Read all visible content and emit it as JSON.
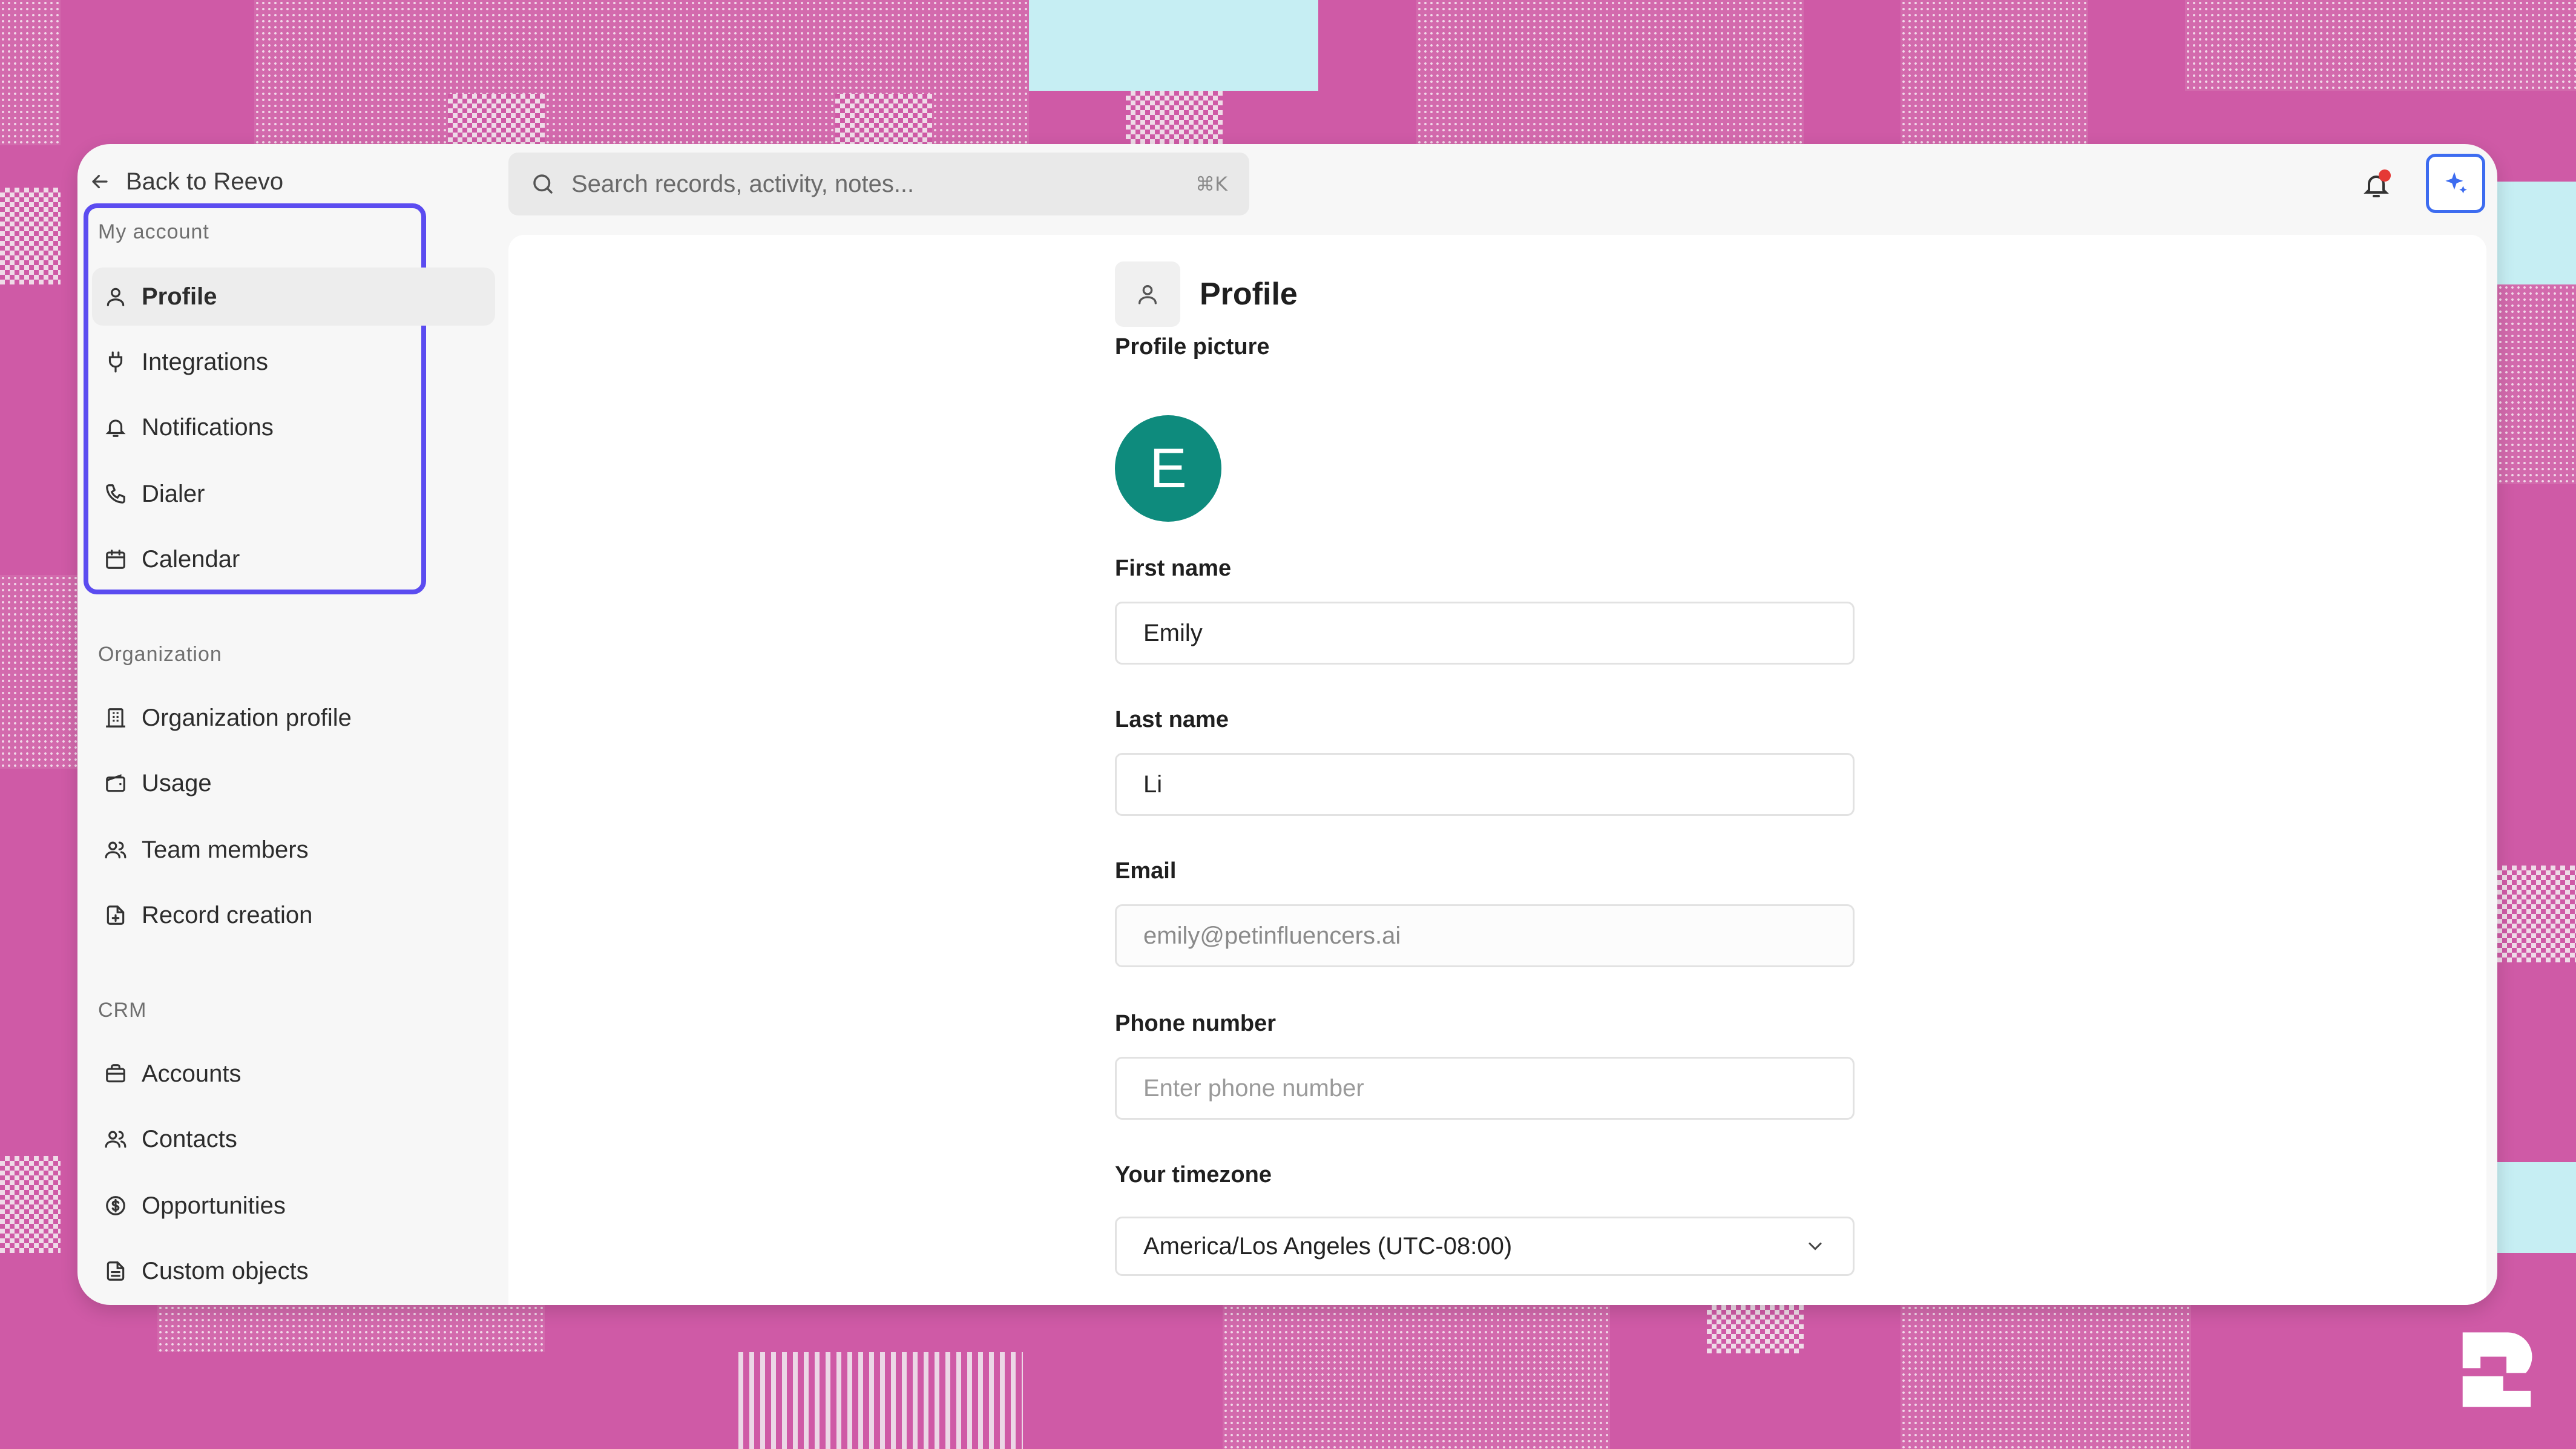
{
  "sidebar": {
    "back_label": "Back to Reevo",
    "sections": {
      "my_account": "My account",
      "organization": "Organization",
      "crm": "CRM"
    },
    "items": {
      "profile": "Profile",
      "integrations": "Integrations",
      "notifications": "Notifications",
      "dialer": "Dialer",
      "calendar": "Calendar",
      "organization_profile": "Organization profile",
      "usage": "Usage",
      "team_members": "Team members",
      "record_creation": "Record creation",
      "accounts": "Accounts",
      "contacts": "Contacts",
      "opportunities": "Opportunities",
      "custom_objects": "Custom objects"
    },
    "active_item": "Profile"
  },
  "search": {
    "placeholder": "Search records, activity, notes...",
    "shortcut": "⌘K"
  },
  "profile": {
    "title": "Profile",
    "picture_label": "Profile picture",
    "avatar_initial": "E",
    "first_name_label": "First name",
    "first_name_value": "Emily",
    "last_name_label": "Last name",
    "last_name_value": "Li",
    "email_label": "Email",
    "email_value": "emily@petinfluencers.ai",
    "phone_label": "Phone number",
    "phone_placeholder": "Enter phone number",
    "timezone_label": "Your timezone",
    "timezone_value": "America/Los Angeles (UTC-08:00)"
  },
  "colors": {
    "accent_highlight": "#5b4cf0",
    "ai_button": "#3d6cf0",
    "avatar_bg": "#0e8b7d",
    "notification_dot": "#e53935",
    "background": "#cf5aa6"
  },
  "icons": {
    "back": "arrow-left-icon",
    "search": "search-icon",
    "bell": "bell-icon",
    "ai": "sparkle-icon",
    "logo": "reevo-logo-icon"
  }
}
